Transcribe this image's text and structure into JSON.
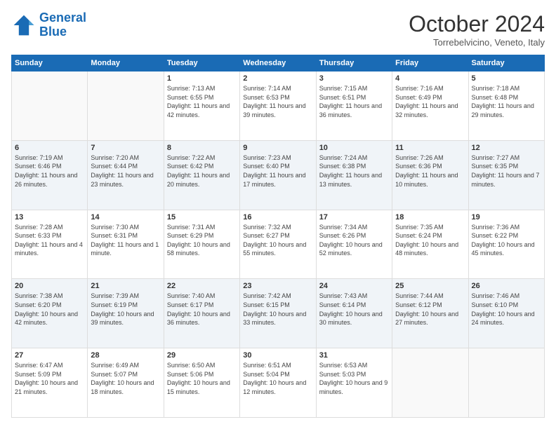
{
  "logo": {
    "line1": "General",
    "line2": "Blue"
  },
  "title": "October 2024",
  "subtitle": "Torrebelvicino, Veneto, Italy",
  "days_of_week": [
    "Sunday",
    "Monday",
    "Tuesday",
    "Wednesday",
    "Thursday",
    "Friday",
    "Saturday"
  ],
  "weeks": [
    [
      {
        "day": "",
        "info": ""
      },
      {
        "day": "",
        "info": ""
      },
      {
        "day": "1",
        "info": "Sunrise: 7:13 AM\nSunset: 6:55 PM\nDaylight: 11 hours and 42 minutes."
      },
      {
        "day": "2",
        "info": "Sunrise: 7:14 AM\nSunset: 6:53 PM\nDaylight: 11 hours and 39 minutes."
      },
      {
        "day": "3",
        "info": "Sunrise: 7:15 AM\nSunset: 6:51 PM\nDaylight: 11 hours and 36 minutes."
      },
      {
        "day": "4",
        "info": "Sunrise: 7:16 AM\nSunset: 6:49 PM\nDaylight: 11 hours and 32 minutes."
      },
      {
        "day": "5",
        "info": "Sunrise: 7:18 AM\nSunset: 6:48 PM\nDaylight: 11 hours and 29 minutes."
      }
    ],
    [
      {
        "day": "6",
        "info": "Sunrise: 7:19 AM\nSunset: 6:46 PM\nDaylight: 11 hours and 26 minutes."
      },
      {
        "day": "7",
        "info": "Sunrise: 7:20 AM\nSunset: 6:44 PM\nDaylight: 11 hours and 23 minutes."
      },
      {
        "day": "8",
        "info": "Sunrise: 7:22 AM\nSunset: 6:42 PM\nDaylight: 11 hours and 20 minutes."
      },
      {
        "day": "9",
        "info": "Sunrise: 7:23 AM\nSunset: 6:40 PM\nDaylight: 11 hours and 17 minutes."
      },
      {
        "day": "10",
        "info": "Sunrise: 7:24 AM\nSunset: 6:38 PM\nDaylight: 11 hours and 13 minutes."
      },
      {
        "day": "11",
        "info": "Sunrise: 7:26 AM\nSunset: 6:36 PM\nDaylight: 11 hours and 10 minutes."
      },
      {
        "day": "12",
        "info": "Sunrise: 7:27 AM\nSunset: 6:35 PM\nDaylight: 11 hours and 7 minutes."
      }
    ],
    [
      {
        "day": "13",
        "info": "Sunrise: 7:28 AM\nSunset: 6:33 PM\nDaylight: 11 hours and 4 minutes."
      },
      {
        "day": "14",
        "info": "Sunrise: 7:30 AM\nSunset: 6:31 PM\nDaylight: 11 hours and 1 minute."
      },
      {
        "day": "15",
        "info": "Sunrise: 7:31 AM\nSunset: 6:29 PM\nDaylight: 10 hours and 58 minutes."
      },
      {
        "day": "16",
        "info": "Sunrise: 7:32 AM\nSunset: 6:27 PM\nDaylight: 10 hours and 55 minutes."
      },
      {
        "day": "17",
        "info": "Sunrise: 7:34 AM\nSunset: 6:26 PM\nDaylight: 10 hours and 52 minutes."
      },
      {
        "day": "18",
        "info": "Sunrise: 7:35 AM\nSunset: 6:24 PM\nDaylight: 10 hours and 48 minutes."
      },
      {
        "day": "19",
        "info": "Sunrise: 7:36 AM\nSunset: 6:22 PM\nDaylight: 10 hours and 45 minutes."
      }
    ],
    [
      {
        "day": "20",
        "info": "Sunrise: 7:38 AM\nSunset: 6:20 PM\nDaylight: 10 hours and 42 minutes."
      },
      {
        "day": "21",
        "info": "Sunrise: 7:39 AM\nSunset: 6:19 PM\nDaylight: 10 hours and 39 minutes."
      },
      {
        "day": "22",
        "info": "Sunrise: 7:40 AM\nSunset: 6:17 PM\nDaylight: 10 hours and 36 minutes."
      },
      {
        "day": "23",
        "info": "Sunrise: 7:42 AM\nSunset: 6:15 PM\nDaylight: 10 hours and 33 minutes."
      },
      {
        "day": "24",
        "info": "Sunrise: 7:43 AM\nSunset: 6:14 PM\nDaylight: 10 hours and 30 minutes."
      },
      {
        "day": "25",
        "info": "Sunrise: 7:44 AM\nSunset: 6:12 PM\nDaylight: 10 hours and 27 minutes."
      },
      {
        "day": "26",
        "info": "Sunrise: 7:46 AM\nSunset: 6:10 PM\nDaylight: 10 hours and 24 minutes."
      }
    ],
    [
      {
        "day": "27",
        "info": "Sunrise: 6:47 AM\nSunset: 5:09 PM\nDaylight: 10 hours and 21 minutes."
      },
      {
        "day": "28",
        "info": "Sunrise: 6:49 AM\nSunset: 5:07 PM\nDaylight: 10 hours and 18 minutes."
      },
      {
        "day": "29",
        "info": "Sunrise: 6:50 AM\nSunset: 5:06 PM\nDaylight: 10 hours and 15 minutes."
      },
      {
        "day": "30",
        "info": "Sunrise: 6:51 AM\nSunset: 5:04 PM\nDaylight: 10 hours and 12 minutes."
      },
      {
        "day": "31",
        "info": "Sunrise: 6:53 AM\nSunset: 5:03 PM\nDaylight: 10 hours and 9 minutes."
      },
      {
        "day": "",
        "info": ""
      },
      {
        "day": "",
        "info": ""
      }
    ]
  ]
}
